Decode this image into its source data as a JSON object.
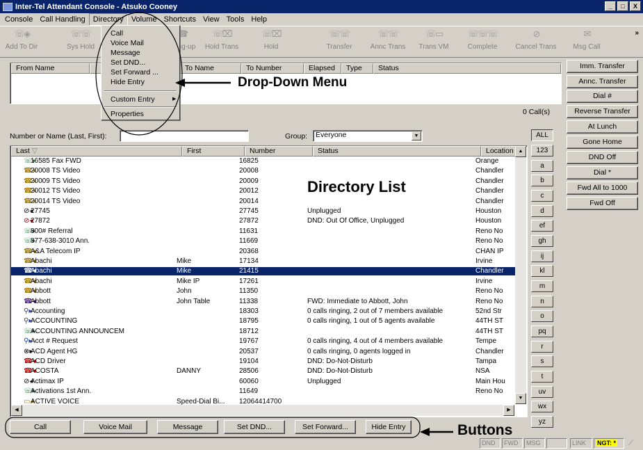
{
  "window": {
    "title": "Inter-Tel Attendant Console - Atsuko Cooney",
    "controls": [
      "_",
      "□",
      "X"
    ]
  },
  "menubar": [
    "Console",
    "Call Handling",
    "Directory",
    "Volume",
    "Shortcuts",
    "View",
    "Tools",
    "Help"
  ],
  "toolbar": {
    "buttons": [
      {
        "label": "Add To Dir",
        "icon": "add-to-directory-icon"
      },
      {
        "label": "Sys Hold",
        "icon": "system-hold-icon"
      },
      {
        "label": "Hang-up",
        "icon": "hang-up-icon"
      },
      {
        "label": "Hold Trans",
        "icon": "hold-transfer-icon"
      },
      {
        "label": "Hold",
        "icon": "hold-icon"
      },
      {
        "label": "Transfer",
        "icon": "transfer-icon"
      },
      {
        "label": "Annc Trans",
        "icon": "announced-transfer-icon"
      },
      {
        "label": "Trans VM",
        "icon": "transfer-voicemail-icon"
      },
      {
        "label": "Complete",
        "icon": "complete-icon"
      },
      {
        "label": "Cancel Trans",
        "icon": "cancel-transfer-icon"
      },
      {
        "label": "Msg Call",
        "icon": "message-call-icon"
      }
    ],
    "more": "»"
  },
  "calls_panel": {
    "columns": [
      "From Name",
      "",
      "To Name",
      "To Number",
      "Elapsed",
      "Type",
      "Status"
    ],
    "count": "0 Call(s)"
  },
  "right_buttons": [
    "Imm. Transfer",
    "Annc. Transfer",
    "Dial #",
    "Reverse Transfer",
    "At Lunch",
    "Gone Home",
    "DND Off",
    "Dial *",
    "Fwd All to 1000",
    "Fwd Off"
  ],
  "search": {
    "label": "Number or Name (Last, First):",
    "value": "",
    "group_label": "Group:",
    "group_value": "Everyone"
  },
  "directory": {
    "columns": [
      "Last",
      "First",
      "Number",
      "Status",
      "Location"
    ],
    "rows": [
      {
        "icon": "phone-line-icon",
        "last": "16585 Fax FWD",
        "first": "",
        "number": "16825",
        "status": "",
        "location": "Orange"
      },
      {
        "icon": "station-icon",
        "last": "20008 TS Video",
        "first": "",
        "number": "20008",
        "status": "",
        "location": "Chandler"
      },
      {
        "icon": "station-icon",
        "last": "20009 TS Video",
        "first": "",
        "number": "20009",
        "status": "",
        "location": "Chandler"
      },
      {
        "icon": "station-icon",
        "last": "20012  TS Video",
        "first": "",
        "number": "20012",
        "status": "",
        "location": "Chandler"
      },
      {
        "icon": "station-icon",
        "last": "20014 TS Video",
        "first": "",
        "number": "20014",
        "status": "",
        "location": "Chandler"
      },
      {
        "icon": "unplugged-icon",
        "last": "27745",
        "first": "",
        "number": "27745",
        "status": "Unplugged",
        "location": "Houston"
      },
      {
        "icon": "dnd-icon",
        "last": "27872",
        "first": "",
        "number": "27872",
        "status": "DND: Out Of Office, Unplugged",
        "location": "Houston"
      },
      {
        "icon": "phone-line-icon",
        "last": "800# Referral",
        "first": "",
        "number": "11631",
        "status": "",
        "location": "Reno No"
      },
      {
        "icon": "phone-line-icon",
        "last": "877-638-3010 Ann.",
        "first": "",
        "number": "11669",
        "status": "",
        "location": "Reno No"
      },
      {
        "icon": "station-icon",
        "last": "A&A Telecom  IP",
        "first": "",
        "number": "20368",
        "status": "",
        "location": "CHAN IP"
      },
      {
        "icon": "station-icon",
        "last": "Abachi",
        "first": "Mike",
        "number": "17134",
        "status": "",
        "location": "Irvine"
      },
      {
        "icon": "station-icon",
        "last": "Abachi",
        "first": "Mike",
        "number": "21415",
        "status": "",
        "location": "Chandler",
        "selected": true
      },
      {
        "icon": "station-icon",
        "last": "Abachi",
        "first": "Mike IP",
        "number": "17261",
        "status": "",
        "location": "Irvine"
      },
      {
        "icon": "station-icon",
        "last": "Abbott",
        "first": "John",
        "number": "11350",
        "status": "",
        "location": "Reno No"
      },
      {
        "icon": "forward-station-icon",
        "last": "Abbott",
        "first": "John Table",
        "number": "11338",
        "status": "FWD: Immediate to Abbott, John",
        "location": "Reno No"
      },
      {
        "icon": "hunt-group-icon",
        "last": "Accounting",
        "first": "",
        "number": "18303",
        "status": "0 calls ringing, 2 out of 7 members available",
        "location": "52nd  Str"
      },
      {
        "icon": "hunt-group-icon",
        "last": "ACCOUNTING",
        "first": "",
        "number": "18795",
        "status": "0 calls ringing, 1 out of 5 agents available",
        "location": "44TH ST"
      },
      {
        "icon": "phone-line-icon",
        "last": "ACCOUNTING ANNOUNCEM",
        "first": "",
        "number": "18712",
        "status": "",
        "location": "44TH ST"
      },
      {
        "icon": "hunt-group-icon",
        "last": "Acct # Request",
        "first": "",
        "number": "19767",
        "status": "0 calls ringing, 4 out of 4 members available",
        "location": "Tempe"
      },
      {
        "icon": "acd-group-icon",
        "last": "ACD Agent HG",
        "first": "",
        "number": "20537",
        "status": "0 calls ringing, 0 agents logged in",
        "location": "Chandler"
      },
      {
        "icon": "dnd-station-icon",
        "last": "ACD Driver",
        "first": "",
        "number": "19104",
        "status": "DND: Do-Not-Disturb",
        "location": "Tampa"
      },
      {
        "icon": "dnd-station-icon",
        "last": "ACOSTA",
        "first": "DANNY",
        "number": "28506",
        "status": "DND: Do-Not-Disturb",
        "location": "NSA"
      },
      {
        "icon": "unplugged-icon",
        "last": "Actimax IP",
        "first": "",
        "number": "60060",
        "status": "Unplugged",
        "location": "Main Hou"
      },
      {
        "icon": "phone-line-icon",
        "last": "Activations 1st Ann.",
        "first": "",
        "number": "11649",
        "status": "",
        "location": "Reno No"
      },
      {
        "icon": "voice-mail-icon",
        "last": "ACTIVE VOICE",
        "first": "Speed-Dial Bi...",
        "number": "12064414700",
        "status": "",
        "location": ""
      }
    ]
  },
  "alpha_index": [
    "ALL",
    "123",
    "a",
    "b",
    "c",
    "d",
    "ef",
    "gh",
    "ij",
    "kl",
    "m",
    "n",
    "o",
    "pq",
    "r",
    "s",
    "t",
    "uv",
    "wx",
    "yz"
  ],
  "bottom_buttons": [
    "Call",
    "Voice Mail",
    "Message",
    "Set DND...",
    "Set Forward...",
    "Hide Entry"
  ],
  "statusbar": {
    "dnd": "DND",
    "fwd": "FWD",
    "msg": "MSG",
    "link": "LINK",
    "ngt": "NGT: *"
  },
  "directory_menu": {
    "items_top": [
      "Call",
      "Voice Mail",
      "Message",
      "Set DND...",
      "Set Forward ...",
      "Hide Entry"
    ],
    "custom_entry": "Custom Entry",
    "properties": "Properties"
  },
  "annotations": {
    "dropdown": "Drop-Down Menu",
    "directory": "Directory List",
    "buttons": "Buttons"
  },
  "colors": {
    "selection": "#0a246a",
    "title_bar": "#0a246a",
    "ngt_highlight": "#ffff00"
  }
}
